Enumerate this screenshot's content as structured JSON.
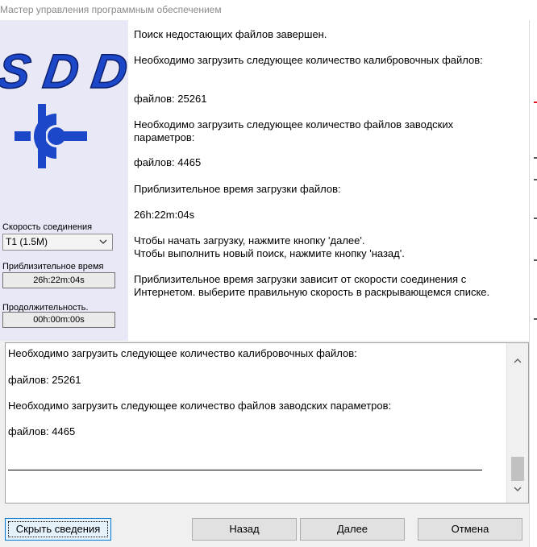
{
  "window": {
    "title": "Мастер управления программным обеспечением"
  },
  "logo": {
    "text": "SDD"
  },
  "sidepanel": {
    "speed_label": "Скорость соединения",
    "speed_value": "T1 (1.5M)",
    "time_label": "Приблизительное время",
    "time_value": "26h:22m:04s",
    "duration_label": "Продолжительность.",
    "duration_value": "00h:00m:00s"
  },
  "messages": [
    "Поиск недостающих файлов завершен.",
    "Необходимо загрузить следующее количество калибровочных файлов:",
    "файлов: 25261",
    "Необходимо загрузить следующее количество файлов заводских параметров:",
    "файлов: 4465",
    "Приблизительное время загрузки файлов:",
    "26h:22m:04s",
    "Чтобы начать загрузку, нажмите кнопку 'далее'.",
    "Чтобы выполнить новый поиск, нажмите кнопку 'назад'.",
    "Приблизительное время загрузки зависит от скорости соединения с Интернетом. выберите правильную скорость в раскрывающемся списке."
  ],
  "details": {
    "lines": [
      "Необходимо загрузить следующее количество калибровочных файлов:",
      "файлов: 25261",
      "Необходимо загрузить следующее количество файлов заводских параметров:",
      "файлов: 4465"
    ]
  },
  "buttons": {
    "hide_details": "Скрыть сведения",
    "back": "Назад",
    "next": "Далее",
    "cancel": "Отмена"
  },
  "colors": {
    "logo_blue": "#1c47c8",
    "panel_bg": "#e8e8f7",
    "accent": "#0078d7"
  }
}
